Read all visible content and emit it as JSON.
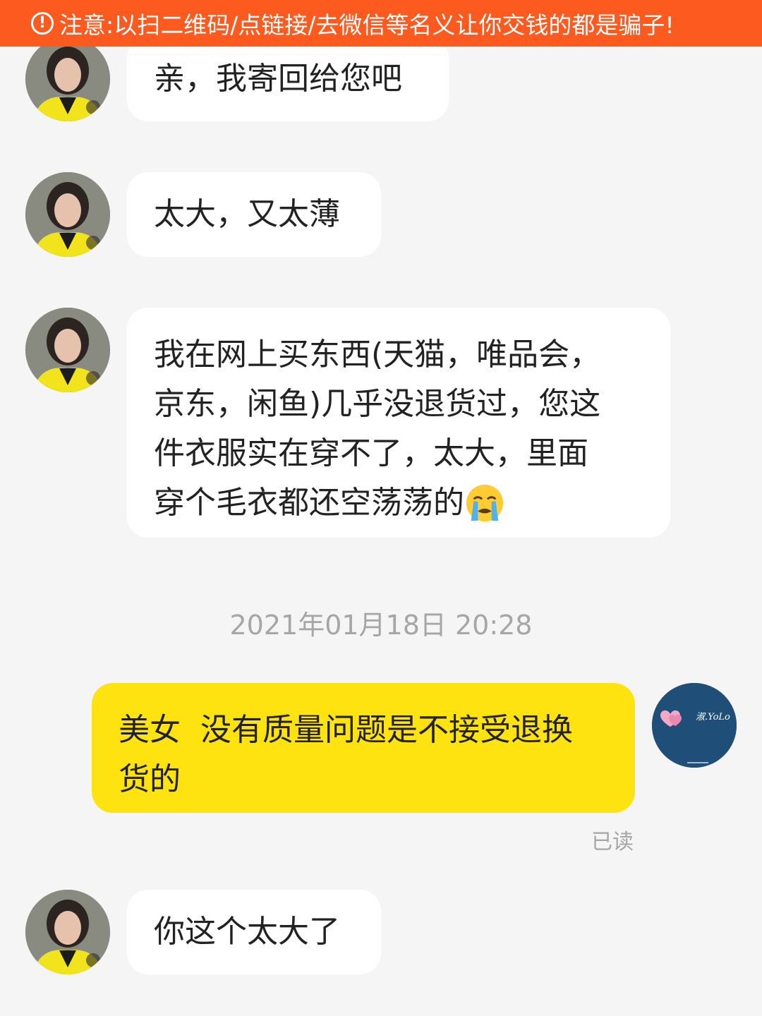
{
  "warning": {
    "icon": "exclamation-circle-icon",
    "text": "注意:以扫二维码/点链接/去微信等名义让你交钱的都是骗子!"
  },
  "colors": {
    "banner": "#fc5a1e",
    "self_bubble": "#fee310",
    "other_bubble": "#ffffff",
    "background": "#f5f5f5"
  },
  "messages": [
    {
      "sender": "other",
      "text": "亲，我寄回给您吧"
    },
    {
      "sender": "other",
      "text": "太大，又太薄"
    },
    {
      "sender": "other",
      "lines": [
        "我在网上买东西(天猫，唯品会，",
        "京东，闲鱼)几乎没退货过，您这",
        "件衣服实在穿不了，太大，里面",
        "穿个毛衣都还空荡荡的"
      ],
      "emoji": "loudly-crying-face-icon"
    },
    {
      "sender": "self",
      "lines": [
        "美女  没有质量问题是不接受退换",
        "货的"
      ]
    },
    {
      "sender": "other",
      "text": "你这个太大了"
    }
  ],
  "timestamp": "2021年01月18日 20:28",
  "read_status": "已读",
  "self_avatar_text": "淑.YoLo"
}
